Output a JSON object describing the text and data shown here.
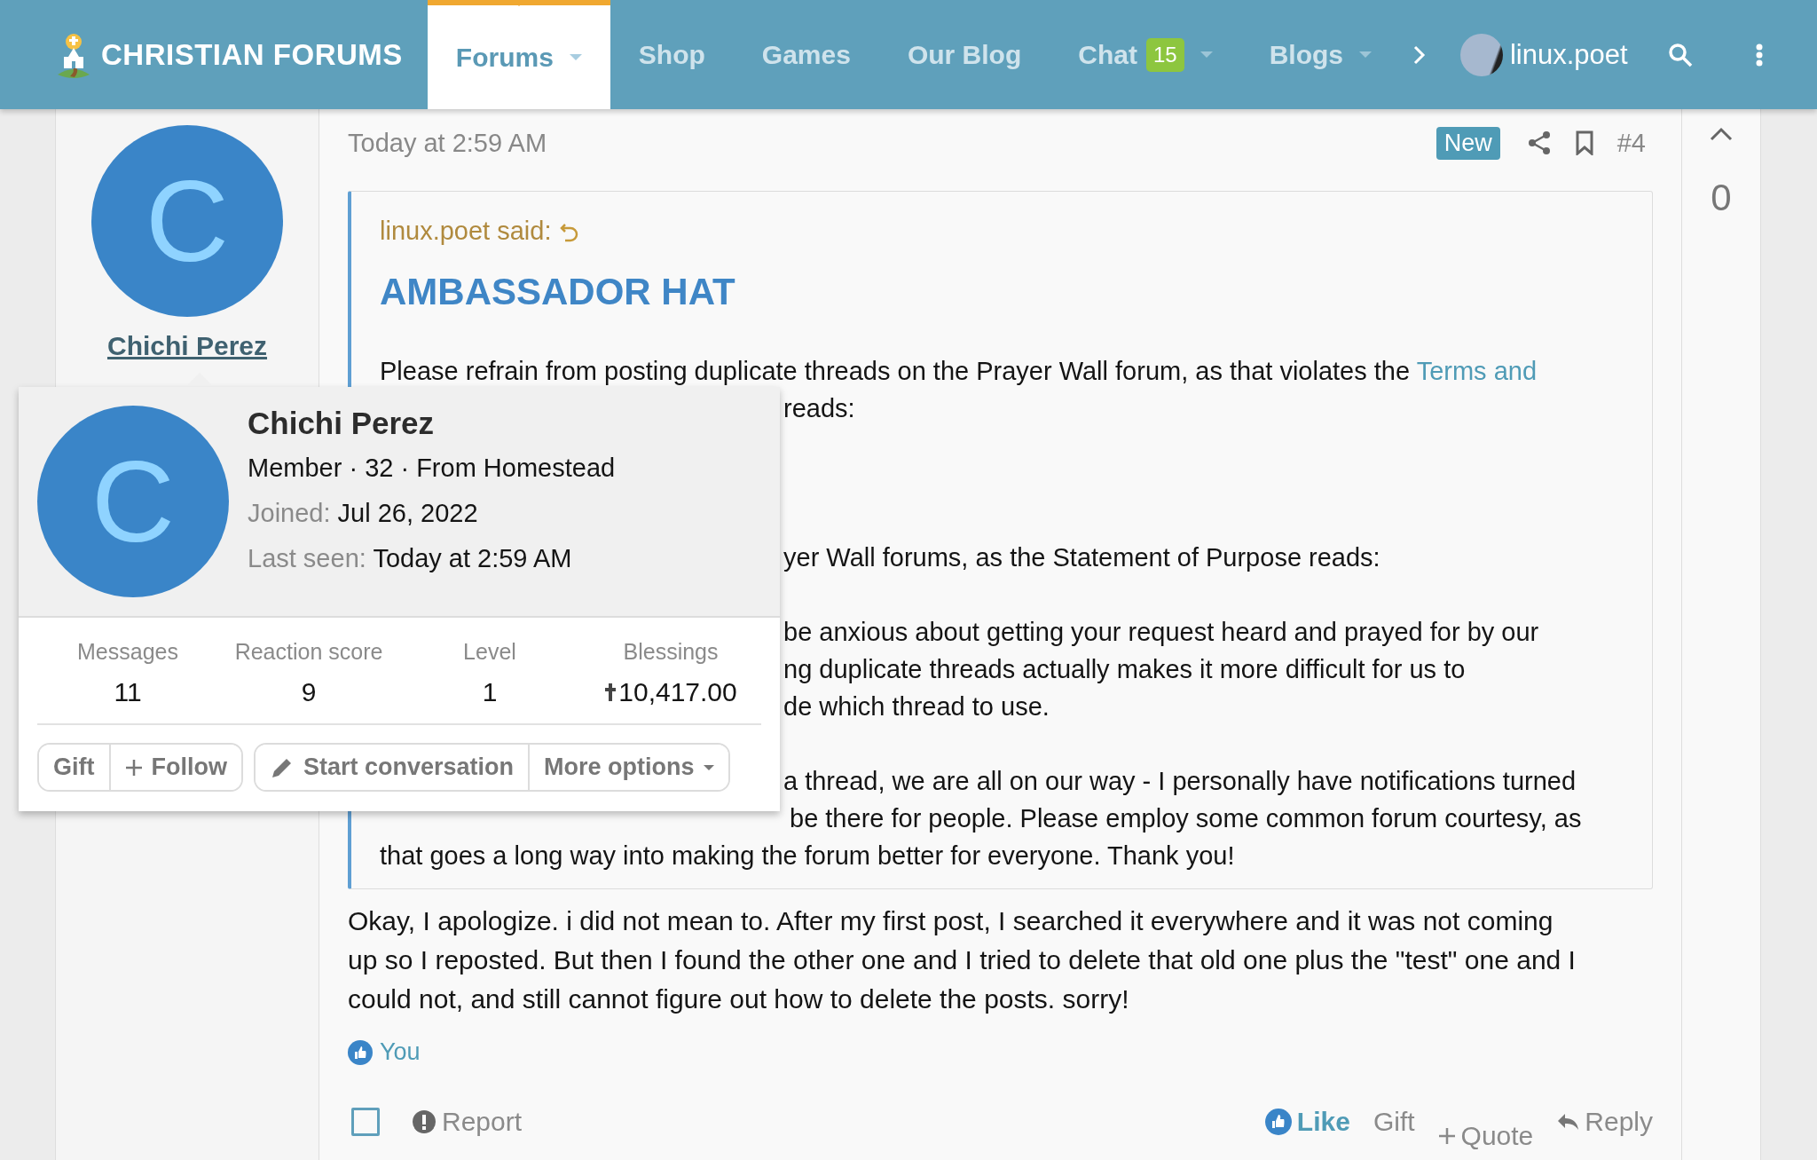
{
  "header": {
    "logo": "CHRISTIAN FORUMS",
    "nav": [
      {
        "label": "Forums",
        "selected": true,
        "dropdown": true
      },
      {
        "label": "Shop",
        "selected": false,
        "dropdown": false
      },
      {
        "label": "Games",
        "selected": false,
        "dropdown": false
      },
      {
        "label": "Our Blog",
        "selected": false,
        "dropdown": false
      },
      {
        "label": "Chat",
        "selected": false,
        "dropdown": true,
        "badge": "15"
      },
      {
        "label": "Blogs",
        "selected": false,
        "dropdown": true
      }
    ],
    "user": "linux.poet"
  },
  "author": {
    "initial": "C",
    "name": "Chichi Perez"
  },
  "post": {
    "date": "Today at 2:59 AM",
    "badge": "New",
    "number": "#4",
    "quote": {
      "attribution": "linux.poet said:",
      "title": "AMBASSADOR HAT",
      "lines": [
        {
          "kind": "full",
          "text": "Please refrain from posting duplicate threads on the Prayer Wall forum, as that violates the ",
          "link": "Terms and"
        },
        {
          "kind": "clipped",
          "text": "reads:"
        },
        {
          "kind": "gap"
        },
        {
          "kind": "gap"
        },
        {
          "kind": "gap"
        },
        {
          "kind": "clipped",
          "text": "yer Wall forums, as the Statement of Purpose reads:"
        },
        {
          "kind": "gap"
        },
        {
          "kind": "clipped",
          "text": "be anxious about getting your request heard and prayed for by our"
        },
        {
          "kind": "clipped",
          "text": "ng duplicate threads actually makes it more difficult for us to"
        },
        {
          "kind": "clipped",
          "text": "de which thread to use."
        },
        {
          "kind": "gap"
        },
        {
          "kind": "clipped",
          "text": "a thread, we are all on our way - I personally have notifications turned"
        },
        {
          "kind": "clipped",
          "text": "be there for people. Please employ some common forum courtesy, as"
        },
        {
          "kind": "full",
          "text": "that goes a long way into making the forum better for everyone. Thank you!"
        }
      ]
    },
    "message": "Okay, I apologize. i did not mean to. After my first post, I searched it everywhere and it was not coming up so I reposted. But then I found the other one and I tried to delete that old one plus the \"test\" one and I could not, and still cannot figure out how to delete the posts. sorry!",
    "reactions": "You",
    "footer": {
      "selected": false,
      "report": "Report",
      "actions": [
        {
          "kind": "like",
          "label": "Like"
        },
        {
          "kind": "gift",
          "label": "Gift"
        },
        {
          "kind": "quote",
          "label": "Quote"
        },
        {
          "kind": "reply",
          "label": "Reply"
        }
      ]
    }
  },
  "votes": {
    "score": "0"
  },
  "popup": {
    "initial": "C",
    "name": "Chichi Perez",
    "meta": "Member · 32 · From Homestead",
    "joined_label": "Joined:",
    "joined": "Jul 26, 2022",
    "seen_label": "Last seen:",
    "seen": "Today at 2:59 AM",
    "stats": [
      {
        "label": "Messages",
        "value": "11"
      },
      {
        "label": "Reaction score",
        "value": "9"
      },
      {
        "label": "Level",
        "value": "1"
      },
      {
        "label": "Blessings",
        "value": "10,417.00",
        "currency": true
      }
    ],
    "buttons": [
      {
        "kind": "gift",
        "label": "Gift"
      },
      {
        "kind": "follow",
        "label": "Follow"
      },
      {
        "kind": "conversation",
        "label": "Start conversation"
      },
      {
        "kind": "more",
        "label": "More options"
      }
    ]
  }
}
